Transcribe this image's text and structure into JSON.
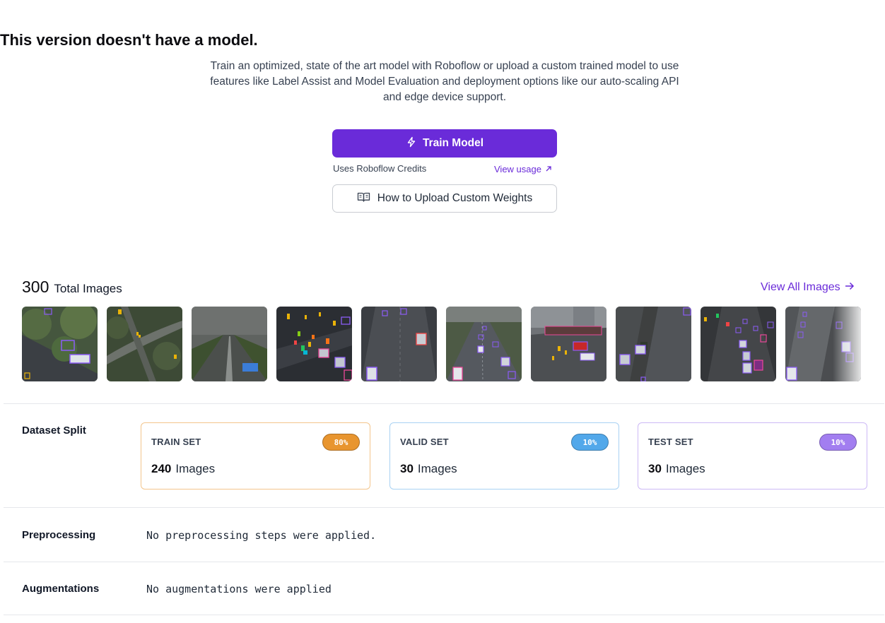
{
  "hero": {
    "title": "This version doesn't have a model.",
    "description": "Train an optimized, state of the art model with Roboflow or upload a custom trained model to use features like Label Assist and Model Evaluation and deployment options like our auto-scaling API and edge device support.",
    "train_button": "Train Model",
    "credits_note": "Uses Roboflow Credits",
    "view_usage": "View usage",
    "upload_button": "How to Upload Custom Weights"
  },
  "images": {
    "total_count": "300",
    "total_label": "Total Images",
    "view_all": "View All Images"
  },
  "dataset_split": {
    "label": "Dataset Split",
    "cards": [
      {
        "name": "TRAIN SET",
        "percent": "80%",
        "count": "240",
        "unit": "Images",
        "color": "#e8952f",
        "border": "#f3c58c"
      },
      {
        "name": "VALID SET",
        "percent": "10%",
        "count": "30",
        "unit": "Images",
        "color": "#52a8ea",
        "border": "#a9d2f3"
      },
      {
        "name": "TEST SET",
        "percent": "10%",
        "count": "30",
        "unit": "Images",
        "color": "#a27ef0",
        "border": "#cdb9f6"
      }
    ]
  },
  "preprocessing": {
    "label": "Preprocessing",
    "value": "No preprocessing steps were applied."
  },
  "augmentations": {
    "label": "Augmentations",
    "value": "No augmentations were applied"
  },
  "colors": {
    "accent": "#6a2bd9",
    "annotation_box": "#8b5cf6"
  },
  "icons": {
    "train": "lightning-icon",
    "view_usage": "arrow-up-right-icon",
    "upload": "book-icon",
    "view_all": "arrow-right-icon"
  }
}
